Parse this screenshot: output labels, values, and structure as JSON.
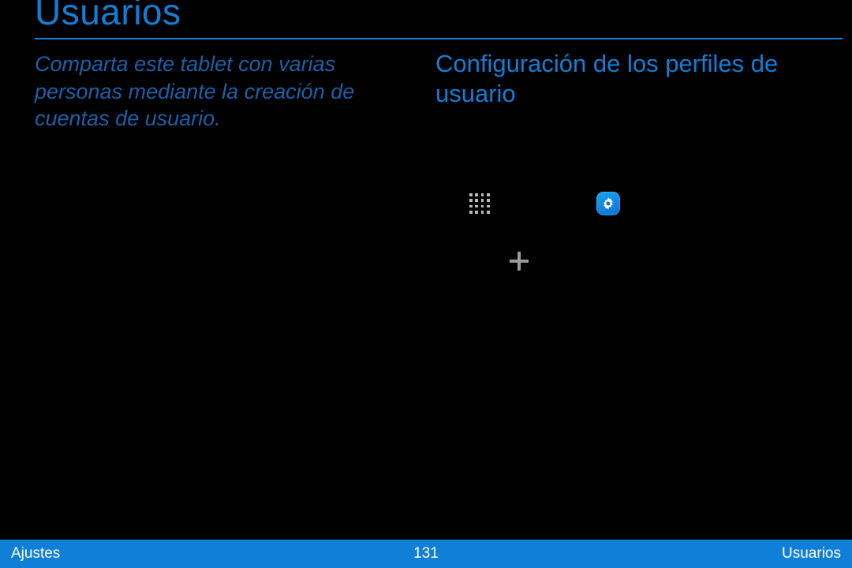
{
  "header": {
    "title": "Usuarios"
  },
  "left": {
    "intro": "Comparta este tablet con varias personas mediante la creación de cuentas de usuario."
  },
  "right": {
    "section_heading": "Configuración de los perfiles de usuario"
  },
  "icons": {
    "apps": "apps-grid-icon",
    "settings": "settings-gear-icon",
    "plus": "plus-icon"
  },
  "footer": {
    "left": "Ajustes",
    "page": "131",
    "right": "Usuarios"
  }
}
